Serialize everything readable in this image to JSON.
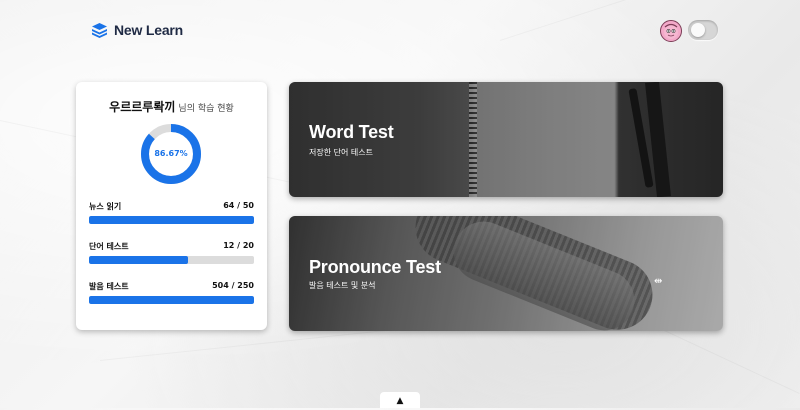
{
  "brand": {
    "name": "New Learn"
  },
  "header": {
    "avatar_icon": "character-avatar-icon",
    "theme_toggle": "theme-toggle"
  },
  "stats": {
    "user_name": "우르르루롹끼",
    "title_suffix": "님의 학습 현황",
    "overall_percent_text": "86.67%",
    "overall_fraction": 0.8667,
    "items": [
      {
        "label": "뉴스 읽기",
        "value": "64 / 50",
        "fill": 1.0
      },
      {
        "label": "단어 테스트",
        "value": "12 / 20",
        "fill": 0.6
      },
      {
        "label": "발음 테스트",
        "value": "504 / 250",
        "fill": 1.0
      }
    ]
  },
  "tests": {
    "word": {
      "title": "Word Test",
      "subtitle": "저장한 단어 테스트"
    },
    "pronounce": {
      "title": "Pronounce Test",
      "subtitle": "발음 테스트 및 분석"
    }
  },
  "scroll_top": {
    "label": "▲"
  },
  "colors": {
    "accent": "#1a73e8",
    "track": "#dcdcdc",
    "brand_text": "#1f2a44"
  }
}
